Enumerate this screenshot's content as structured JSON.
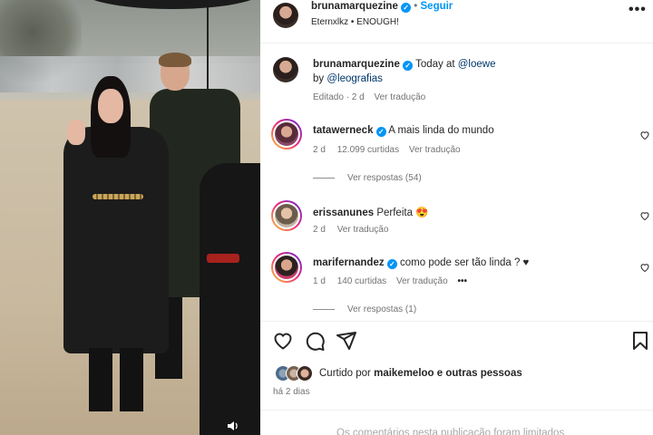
{
  "photo": {
    "sound_icon": "speaker-icon"
  },
  "post": {
    "author": "brunamarquezine",
    "follow_label": "Seguir",
    "separator": "•",
    "audio": "Eternxlkz • ENOUGH!",
    "more_icon": "•••"
  },
  "caption": {
    "author": "brunamarquezine",
    "text_prefix": "Today at",
    "mention1": "@loewe",
    "by_label": "by",
    "mention2": "@leografias",
    "edited": "Editado · 2 d",
    "translate": "Ver tradução"
  },
  "comments": [
    {
      "user": "tatawerneck",
      "text": "A mais linda do mundo",
      "time": "2 d",
      "likes": "12.099 curtidas",
      "translate": "Ver tradução",
      "replies": "Ver respostas (54)"
    },
    {
      "user": "erissanunes",
      "text": "Perfeita 😍",
      "time": "2 d",
      "translate": "Ver tradução"
    },
    {
      "user": "marifernandez",
      "text": "como pode ser tão linda ? ♥",
      "time": "1 d",
      "likes": "140 curtidas",
      "translate": "Ver tradução",
      "more": "•••",
      "replies": "Ver respostas (1)"
    }
  ],
  "likes": {
    "prefix": "Curtido por",
    "user": "maikemeloo",
    "suffix": "e outras pessoas",
    "time": "há 2 dias"
  },
  "footer": {
    "limited": "Os comentários nesta publicação foram limitados"
  },
  "colors": {
    "accent": "#0095f6",
    "link": "#00376b",
    "muted": "#737373"
  }
}
